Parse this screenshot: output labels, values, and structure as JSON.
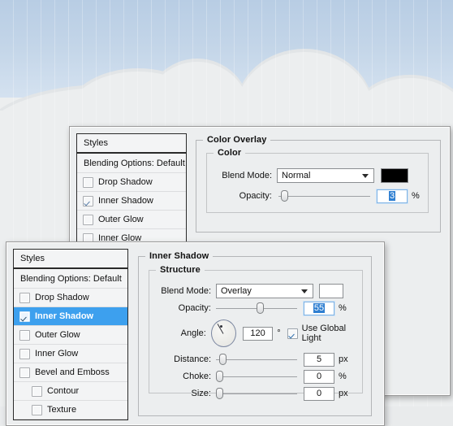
{
  "scene": {
    "sky_color": "#c3d5e8",
    "cloud_color": "#eceeef",
    "cloud_shade_color": "#e2e5e7"
  },
  "dialog_back": {
    "styles_panel": {
      "header": "Styles",
      "blending_options": "Blending Options: Default",
      "items": [
        {
          "label": "Drop Shadow",
          "checked": false,
          "selected": false,
          "indent": false
        },
        {
          "label": "Inner Shadow",
          "checked": true,
          "selected": false,
          "indent": false
        },
        {
          "label": "Outer Glow",
          "checked": false,
          "selected": false,
          "indent": false
        },
        {
          "label": "Inner Glow",
          "checked": false,
          "selected": false,
          "indent": false
        }
      ]
    },
    "section_title": "Color Overlay",
    "group_title": "Color",
    "blend_mode_label": "Blend Mode:",
    "blend_mode_value": "Normal",
    "color_swatch": "#000000",
    "opacity_label": "Opacity:",
    "opacity_value": "3",
    "opacity_unit": "%",
    "opacity_percent": 3
  },
  "dialog_front": {
    "styles_panel": {
      "header": "Styles",
      "blending_options": "Blending Options: Default",
      "items": [
        {
          "label": "Drop Shadow",
          "checked": false,
          "selected": false,
          "indent": false
        },
        {
          "label": "Inner Shadow",
          "checked": true,
          "selected": true,
          "indent": false
        },
        {
          "label": "Outer Glow",
          "checked": false,
          "selected": false,
          "indent": false
        },
        {
          "label": "Inner Glow",
          "checked": false,
          "selected": false,
          "indent": false
        },
        {
          "label": "Bevel and Emboss",
          "checked": false,
          "selected": false,
          "indent": false
        },
        {
          "label": "Contour",
          "checked": false,
          "selected": false,
          "indent": true
        },
        {
          "label": "Texture",
          "checked": false,
          "selected": false,
          "indent": true
        }
      ]
    },
    "section_title": "Inner Shadow",
    "group_title": "Structure",
    "blend_mode_label": "Blend Mode:",
    "blend_mode_value": "Overlay",
    "color_swatch": "#ffffff",
    "opacity_label": "Opacity:",
    "opacity_value": "55",
    "opacity_unit": "%",
    "opacity_percent": 55,
    "angle_label": "Angle:",
    "angle_value": "120",
    "angle_unit": "°",
    "angle_degrees": 120,
    "global_light_label": "Use Global Light",
    "global_light_checked": true,
    "distance_label": "Distance:",
    "distance_value": "5",
    "distance_unit": "px",
    "distance_percent": 4,
    "choke_label": "Choke:",
    "choke_value": "0",
    "choke_unit": "%",
    "choke_percent": 0,
    "size_label": "Size:",
    "size_value": "0",
    "size_unit": "px",
    "size_percent": 0
  }
}
